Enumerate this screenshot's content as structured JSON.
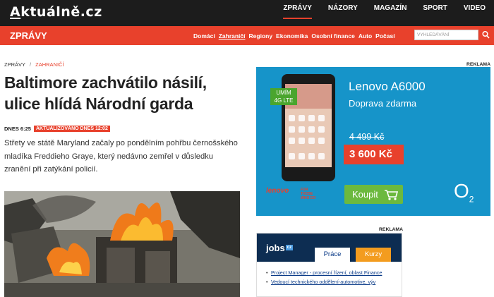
{
  "site": {
    "logo": "Aktuálně.cz",
    "logo_first_letter": "A",
    "logo_rest": "ktuálně.cz"
  },
  "topnav": [
    {
      "label": "ZPRÁVY",
      "active": true
    },
    {
      "label": "NÁZORY"
    },
    {
      "label": "MAGAZÍN"
    },
    {
      "label": "SPORT"
    },
    {
      "label": "VIDEO"
    }
  ],
  "section": {
    "title": "ZPRÁVY",
    "nav": [
      {
        "label": "Domácí"
      },
      {
        "label": "Zahraničí",
        "active": true
      },
      {
        "label": "Regiony"
      },
      {
        "label": "Ekonomika"
      },
      {
        "label": "Osobní finance"
      },
      {
        "label": "Auto"
      },
      {
        "label": "Počasí"
      }
    ],
    "search_placeholder": "VYHLEDÁVÁNÍ"
  },
  "breadcrumb": {
    "root": "ZPRÁVY",
    "separator": "/",
    "current": "ZAHRANIČÍ"
  },
  "article": {
    "title": "Baltimore zachvátilo násilí, ulice hlídá Národní garda",
    "time": "DNES 6:25",
    "updated_badge": "AKTUALIZOVÁNO DNES 12:02",
    "perex": "Střety ve státě Maryland začaly po pondělním pohřbu černošského mladíka Freddieho Graye, který nedávno zemřel v důsledku zranění při zatýkání policií."
  },
  "ads": {
    "label": "REKLAMA",
    "lenovo": {
      "product": "Lenovo A6000",
      "shipping": "Doprava zdarma",
      "old_price": "4 499 Kč",
      "price": "3 600 Kč",
      "buy": "Koupit",
      "lte_line1": "UMÍM",
      "lte_line2": "4G LTE",
      "brand": "lenovo",
      "brand_sub1": "FOR",
      "brand_sub2": "THOSE",
      "brand_sub3": "WHO DO",
      "operator": "O",
      "operator_sub": "2",
      "accent": "#1694c9"
    },
    "jobs": {
      "logo": "jobs",
      "logo_cz": "cz",
      "tab_prace": "Práce",
      "tab_kurzy": "Kurzy",
      "items": [
        "Project Manager - procesní řízení, oblast Finance",
        "Vedoucí technického oddělení-automotive, výv"
      ]
    }
  },
  "colors": {
    "brand": "#e8412c",
    "topbar": "#1c1c1c",
    "jobs_navy": "#0d2d52",
    "jobs_orange": "#f39c1f"
  }
}
